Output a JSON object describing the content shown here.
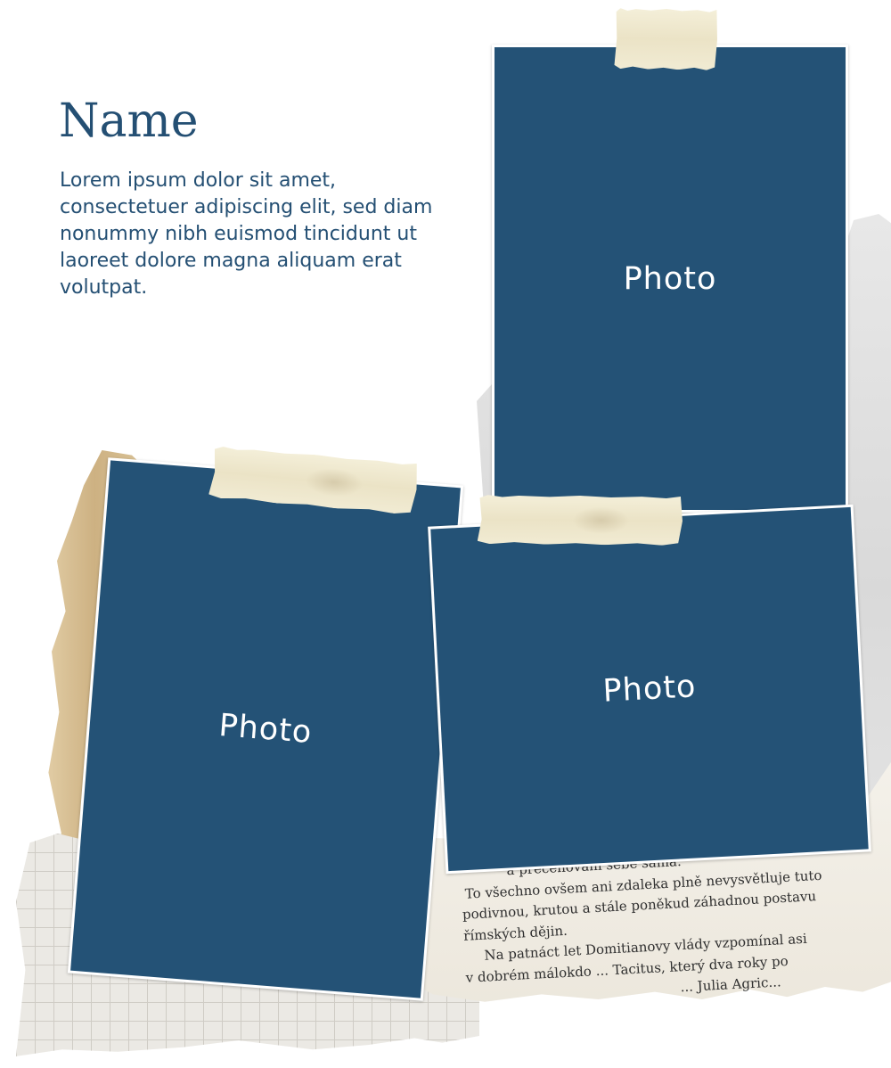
{
  "heading": "Name",
  "body_text": "Lorem ipsum dolor sit amet, consectetuer adipiscing elit, sed diam nonummy nibh euismod tincidunt ut laoreet dolore magna aliquam erat volutpat.",
  "photos": [
    {
      "label": "Photo"
    },
    {
      "label": "Photo"
    },
    {
      "label": "Photo"
    }
  ],
  "book_lines": [
    "a přeceňování sebe sama.",
    "To všechno ovšem ani zdaleka plně nevysvětluje tuto",
    "podivnou, krutou a stále poněkud záhadnou postavu",
    "římských dějin.",
    "Na patnáct let Domitianovy vlády vzpomínal asi",
    "v dobrém málokdo ... Tacitus, který dva roky po",
    "... Julia Agric..."
  ],
  "colors": {
    "accent": "#244f73",
    "photo_fill": "#245276",
    "photo_text": "#ffffff",
    "background": "#ffffff"
  }
}
